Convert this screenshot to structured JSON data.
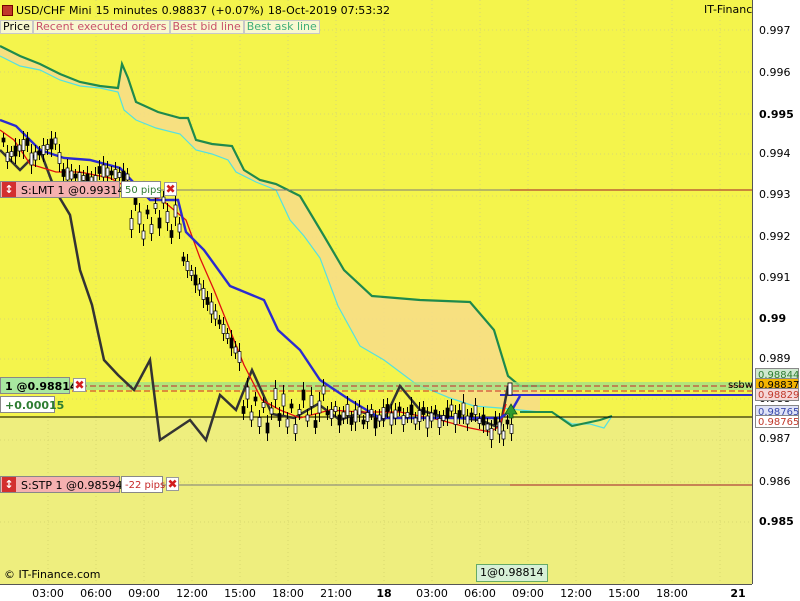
{
  "header": {
    "instrument": "USD/CHF Mini",
    "timeframe": "15 minutes",
    "price": "0.98837",
    "change": "(+0.07%)",
    "datetime": "18-Oct-2019 07:53:32",
    "brand": "IT-Finance.com"
  },
  "legend": [
    {
      "label": "Price",
      "color": "#000000"
    },
    {
      "label": "Recent executed orders",
      "color": "#c8506a"
    },
    {
      "label": "Best bid line",
      "color": "#c8506a"
    },
    {
      "label": "Best ask line",
      "color": "#3fae78"
    }
  ],
  "orders": {
    "limit": {
      "arrow": "↕",
      "label": "S:LMT 1 @0.99314",
      "pips": "50 pips",
      "close": "✖"
    },
    "position": {
      "label": "1 @0.98814",
      "close": "✖",
      "pnl": "+0.00015"
    },
    "stop": {
      "arrow": "↕",
      "label": "S:STP 1 @0.98594",
      "pips": "-22 pips",
      "close": "✖"
    }
  },
  "y_axis": {
    "labels": [
      {
        "text": "0.997",
        "major": false
      },
      {
        "text": "0.996",
        "major": false
      },
      {
        "text": "0.995",
        "major": true
      },
      {
        "text": "0.994",
        "major": false
      },
      {
        "text": "0.993",
        "major": false
      },
      {
        "text": "0.992",
        "major": false
      },
      {
        "text": "0.991",
        "major": false
      },
      {
        "text": "0.99",
        "major": true
      },
      {
        "text": "0.989",
        "major": false
      },
      {
        "text": "0.988",
        "major": false
      },
      {
        "text": "0.987",
        "major": false
      },
      {
        "text": "0.986",
        "major": false
      },
      {
        "text": "0.985",
        "major": true
      }
    ],
    "price_boxes": [
      {
        "text": "0.98844",
        "bg": "#cfe8cf",
        "color": "#2e7d32"
      },
      {
        "text": "0.98837",
        "bg": "#f4b400",
        "color": "#000000"
      },
      {
        "text": "0.98829",
        "bg": "#f5d7d7",
        "color": "#c0392b"
      },
      {
        "text": "0.98765",
        "bg": "#dfe3f7",
        "color": "#3949ab"
      },
      {
        "text": "0.98765",
        "bg": "#ffffff",
        "color": "#c0392b"
      }
    ],
    "side_label": "ssbw"
  },
  "x_axis": {
    "labels": [
      {
        "text": "03:00",
        "day": false
      },
      {
        "text": "06:00",
        "day": false
      },
      {
        "text": "09:00",
        "day": false
      },
      {
        "text": "12:00",
        "day": false
      },
      {
        "text": "15:00",
        "day": false
      },
      {
        "text": "18:00",
        "day": false
      },
      {
        "text": "21:00",
        "day": false
      },
      {
        "text": "18",
        "day": true
      },
      {
        "text": "03:00",
        "day": false
      },
      {
        "text": "06:00",
        "day": false
      },
      {
        "text": "09:00",
        "day": false
      },
      {
        "text": "12:00",
        "day": false
      },
      {
        "text": "15:00",
        "day": false
      },
      {
        "text": "18:00",
        "day": false
      },
      {
        "text": "21",
        "day": true
      }
    ]
  },
  "fill_info": "1@0.98814",
  "copyright": "© IT-Finance.com",
  "colors": {
    "plot_bg": "#f4f44c",
    "cloud": "#f7dc8a",
    "cloud_upper": "#1f8a4c",
    "cloud_lower": "#55e0e0",
    "kijun": "#2b2bd0",
    "tenkan": "#e01010",
    "chikou": "#333333",
    "limit_tag": "#f5b0b0",
    "position_tag": "#a8e8a0",
    "stop_tag": "#f5b0b0",
    "limit_line": "#a0182a"
  }
}
